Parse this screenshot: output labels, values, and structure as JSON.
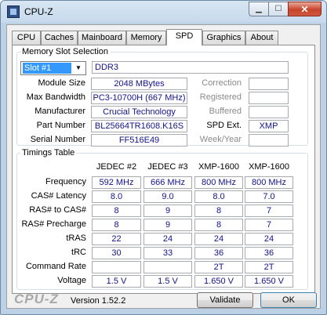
{
  "window": {
    "title": "CPU-Z",
    "close_glyph": "✕",
    "min_glyph": "▁",
    "max_glyph": "☐"
  },
  "tabs": [
    "CPU",
    "Caches",
    "Mainboard",
    "Memory",
    "SPD",
    "Graphics",
    "About"
  ],
  "active_tab": "SPD",
  "slot_selection": {
    "legend": "Memory Slot Selection",
    "slot_value": "Slot #1",
    "memory_type": "DDR3",
    "labels": {
      "module_size": "Module Size",
      "max_bandwidth": "Max Bandwidth",
      "manufacturer": "Manufacturer",
      "part_number": "Part Number",
      "serial_number": "Serial Number",
      "correction": "Correction",
      "registered": "Registered",
      "buffered": "Buffered",
      "spd_ext": "SPD Ext.",
      "week_year": "Week/Year"
    },
    "values": {
      "module_size": "2048 MBytes",
      "max_bandwidth": "PC3-10700H (667 MHz)",
      "manufacturer": "Crucial Technology",
      "part_number": "BL25664TR1608.K16S",
      "serial_number": "FF516E49",
      "correction": "",
      "registered": "",
      "buffered": "",
      "spd_ext": "XMP",
      "week_year": ""
    }
  },
  "timings": {
    "legend": "Timings Table",
    "columns": [
      "JEDEC #2",
      "JEDEC #3",
      "XMP-1600",
      "XMP-1600"
    ],
    "rows": [
      {
        "label": "Frequency",
        "values": [
          "592 MHz",
          "666 MHz",
          "800 MHz",
          "800 MHz"
        ]
      },
      {
        "label": "CAS# Latency",
        "values": [
          "8.0",
          "9.0",
          "8.0",
          "7.0"
        ]
      },
      {
        "label": "RAS# to CAS#",
        "values": [
          "8",
          "9",
          "8",
          "7"
        ]
      },
      {
        "label": "RAS# Precharge",
        "values": [
          "8",
          "9",
          "8",
          "7"
        ]
      },
      {
        "label": "tRAS",
        "values": [
          "22",
          "24",
          "24",
          "24"
        ]
      },
      {
        "label": "tRC",
        "values": [
          "30",
          "33",
          "36",
          "36"
        ]
      },
      {
        "label": "Command Rate",
        "values": [
          "",
          "",
          "2T",
          "2T"
        ]
      },
      {
        "label": "Voltage",
        "values": [
          "1.5 V",
          "1.5 V",
          "1.650 V",
          "1.650 V"
        ]
      }
    ]
  },
  "footer": {
    "logo": "CPU-Z",
    "version": "Version 1.52.2",
    "validate_label": "Validate",
    "ok_label": "OK"
  }
}
